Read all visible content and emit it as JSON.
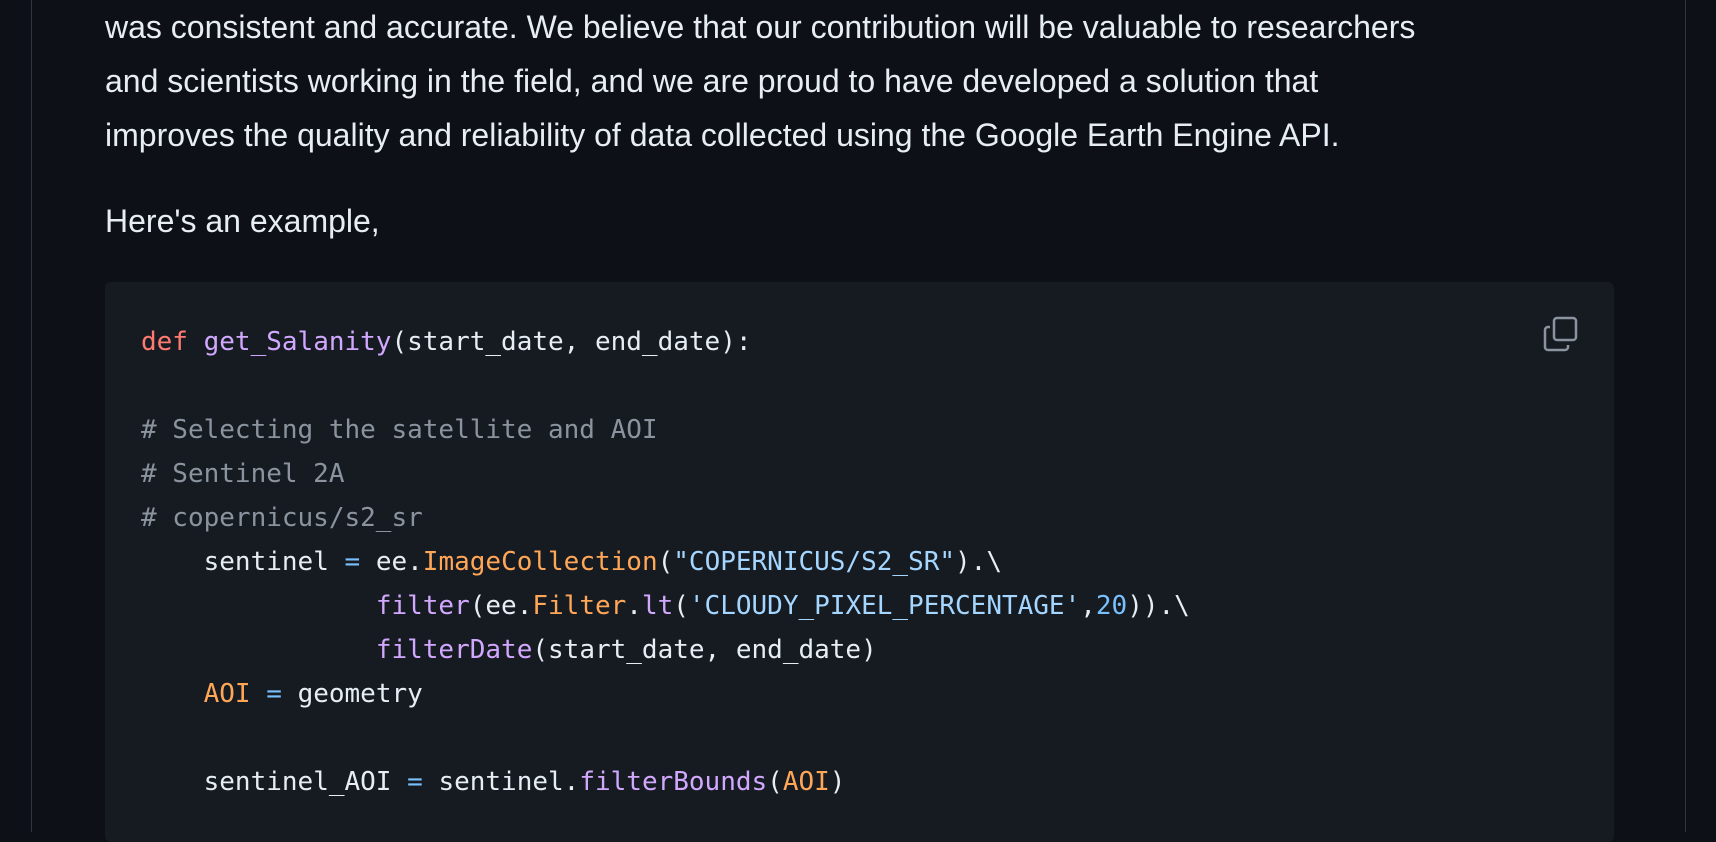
{
  "article": {
    "paragraph_lines": [
      "was consistent and accurate. We believe that our contribution will be valuable to researchers",
      "and scientists working in the field, and we are proud to have developed a solution that",
      "improves the quality and reliability of data collected using the Google Earth Engine API."
    ],
    "example_intro": "Here's an example,"
  },
  "code_block": {
    "copy_icon": "copy-icon",
    "colors": {
      "background": "#161b22",
      "keyword": "#ff7b72",
      "function": "#d2a8ff",
      "comment": "#8b949e",
      "string": "#a5d6ff",
      "number": "#79c0ff",
      "class": "#ffa657"
    },
    "tokens": {
      "l1_def": "def",
      "l1_fn": "get_Salanity",
      "l1_rest": "(start_date, end_date):",
      "l3_comment": "# Selecting the satellite and AOI",
      "l4_comment": "# Sentinel 2A",
      "l5_comment": "# copernicus/s2_sr",
      "l6_var": "sentinel",
      "l6_eq": "=",
      "l6_ee": "ee.",
      "l6_cls": "ImageCollection",
      "l6_open": "(",
      "l6_str": "\"COPERNICUS/S2_SR\"",
      "l6_close": ").\\",
      "l7_fn": "filter",
      "l7_a": "(ee.",
      "l7_cls": "Filter",
      "l7_dot": ".",
      "l7_fn2": "lt",
      "l7_open": "(",
      "l7_str": "'CLOUDY_PIXEL_PERCENTAGE'",
      "l7_comma": ",",
      "l7_num": "20",
      "l7_close": ")).\\",
      "l8_fn": "filterDate",
      "l8_rest": "(start_date, end_date)",
      "l9_var": "AOI",
      "l9_eq": "=",
      "l9_val": "geometry",
      "l11_var": "sentinel_AOI",
      "l11_eq": "=",
      "l11_obj": "sentinel.",
      "l11_fn": "filterBounds",
      "l11_open": "(",
      "l11_arg": "AOI",
      "l11_close": ")"
    }
  }
}
